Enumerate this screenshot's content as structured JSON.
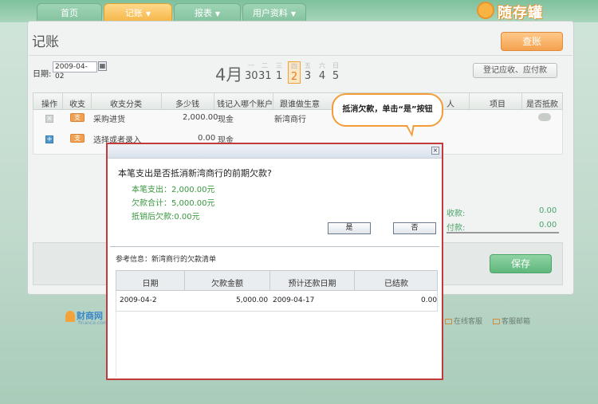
{
  "nav": {
    "tabs": [
      {
        "label": "首页",
        "active": false,
        "has_caret": false
      },
      {
        "label": "记账",
        "active": true,
        "has_caret": true
      },
      {
        "label": "报表",
        "active": false,
        "has_caret": true
      },
      {
        "label": "用户资料",
        "active": false,
        "has_caret": true
      }
    ],
    "brand": "随存罐"
  },
  "page": {
    "title": "记账",
    "check_button": "查账",
    "date_label": "日期:",
    "date_value": "2009-04-02",
    "calendar_icon": "calendar-icon",
    "month": "4月",
    "days": [
      {
        "weekday": "一",
        "day": "30",
        "selected": false
      },
      {
        "weekday": "二",
        "day": "31",
        "selected": false
      },
      {
        "weekday": "三",
        "day": "1",
        "selected": false
      },
      {
        "weekday": "四",
        "day": "2",
        "selected": true
      },
      {
        "weekday": "五",
        "day": "3",
        "selected": false
      },
      {
        "weekday": "六",
        "day": "4",
        "selected": false
      },
      {
        "weekday": "日",
        "day": "5",
        "selected": false
      }
    ],
    "ar_ap_button": "登记应收、应付款"
  },
  "grid": {
    "columns": [
      "操作",
      "收支",
      "收支分类",
      "多少钱",
      "钱记入哪个账户",
      "跟谁做生意",
      "人",
      "项目",
      "是否抵款"
    ],
    "rows": [
      {
        "op_icon": "delete-icon",
        "type": "支",
        "category": "采购进货",
        "amount": "2,000.00",
        "account": "现金",
        "partner": "新湾商行"
      },
      {
        "op_icon": "add-icon",
        "type": "支",
        "category": "选择或者录入",
        "amount": "0.00",
        "account": "现金",
        "partner": ""
      }
    ]
  },
  "callout": {
    "text": "抵消欠款，单击“是”按钮",
    "border_color": "#f39c38"
  },
  "summary": {
    "receipts_label": "收款:",
    "receipts_value": "0.00",
    "payments_label": "付款:",
    "payments_value": "0.00"
  },
  "save_button": "保存",
  "footer": {
    "logo_text": "财商网",
    "logo_sub": "finance.com",
    "online_service": "在线客服",
    "service_email": "客服邮箱"
  },
  "dialog": {
    "question": "本笔支出是否抵消新湾商行的前期欠款?",
    "lines": [
      "本笔支出：2,000.00元",
      "欠款合计：5,000.00元",
      "抵销后欠款:0.00元"
    ],
    "yes_button": "是",
    "no_button": "否",
    "ref_title": "参考信息：新湾商行的欠款清单",
    "ref_columns": [
      "日期",
      "欠款金额",
      "预计还款日期",
      "已结款"
    ],
    "ref_rows": [
      {
        "date": "2009-04-2",
        "amount": "5,000.00",
        "due_date": "2009-04-17",
        "paid": "0.00"
      }
    ],
    "border_color": "#c23a3a",
    "accent_color": "#39963f"
  }
}
